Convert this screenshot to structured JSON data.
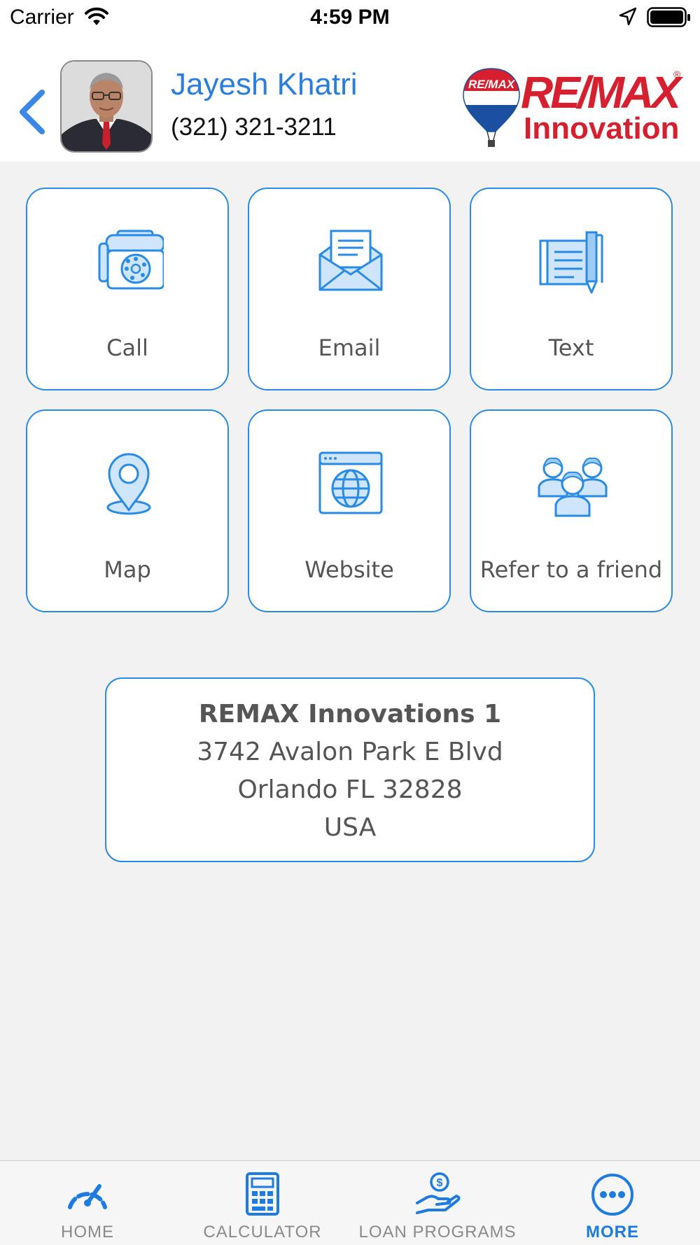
{
  "status_bar": {
    "carrier": "Carrier",
    "time": "4:59 PM"
  },
  "header": {
    "agent_name": "Jayesh Khatri",
    "agent_phone": "(321) 321-3211",
    "logo": {
      "top_text": "RE/MAX",
      "sub_text": "Innovation",
      "balloon_text": "RE/MAX"
    }
  },
  "actions": [
    {
      "label": "Call",
      "icon": "telephone-icon"
    },
    {
      "label": "Email",
      "icon": "envelope-icon"
    },
    {
      "label": "Text",
      "icon": "document-pen-icon"
    },
    {
      "label": "Map",
      "icon": "map-pin-icon"
    },
    {
      "label": "Website",
      "icon": "globe-browser-icon"
    },
    {
      "label": "Refer to a friend",
      "icon": "people-group-icon"
    }
  ],
  "address": {
    "office": "REMAX Innovations 1",
    "street": "3742 Avalon Park E Blvd",
    "city_line": "Orlando FL 32828",
    "country": "USA"
  },
  "tabs": [
    {
      "label": "HOME",
      "icon": "speedometer-icon",
      "active": false
    },
    {
      "label": "CALCULATOR",
      "icon": "calculator-icon",
      "active": false
    },
    {
      "label": "LOAN PROGRAMS",
      "icon": "money-hand-icon",
      "active": false
    },
    {
      "label": "MORE",
      "icon": "more-dots-icon",
      "active": true
    }
  ],
  "colors": {
    "accent": "#2a8be6",
    "brand_red": "#d6202f",
    "active_tab": "#1e7be2"
  }
}
